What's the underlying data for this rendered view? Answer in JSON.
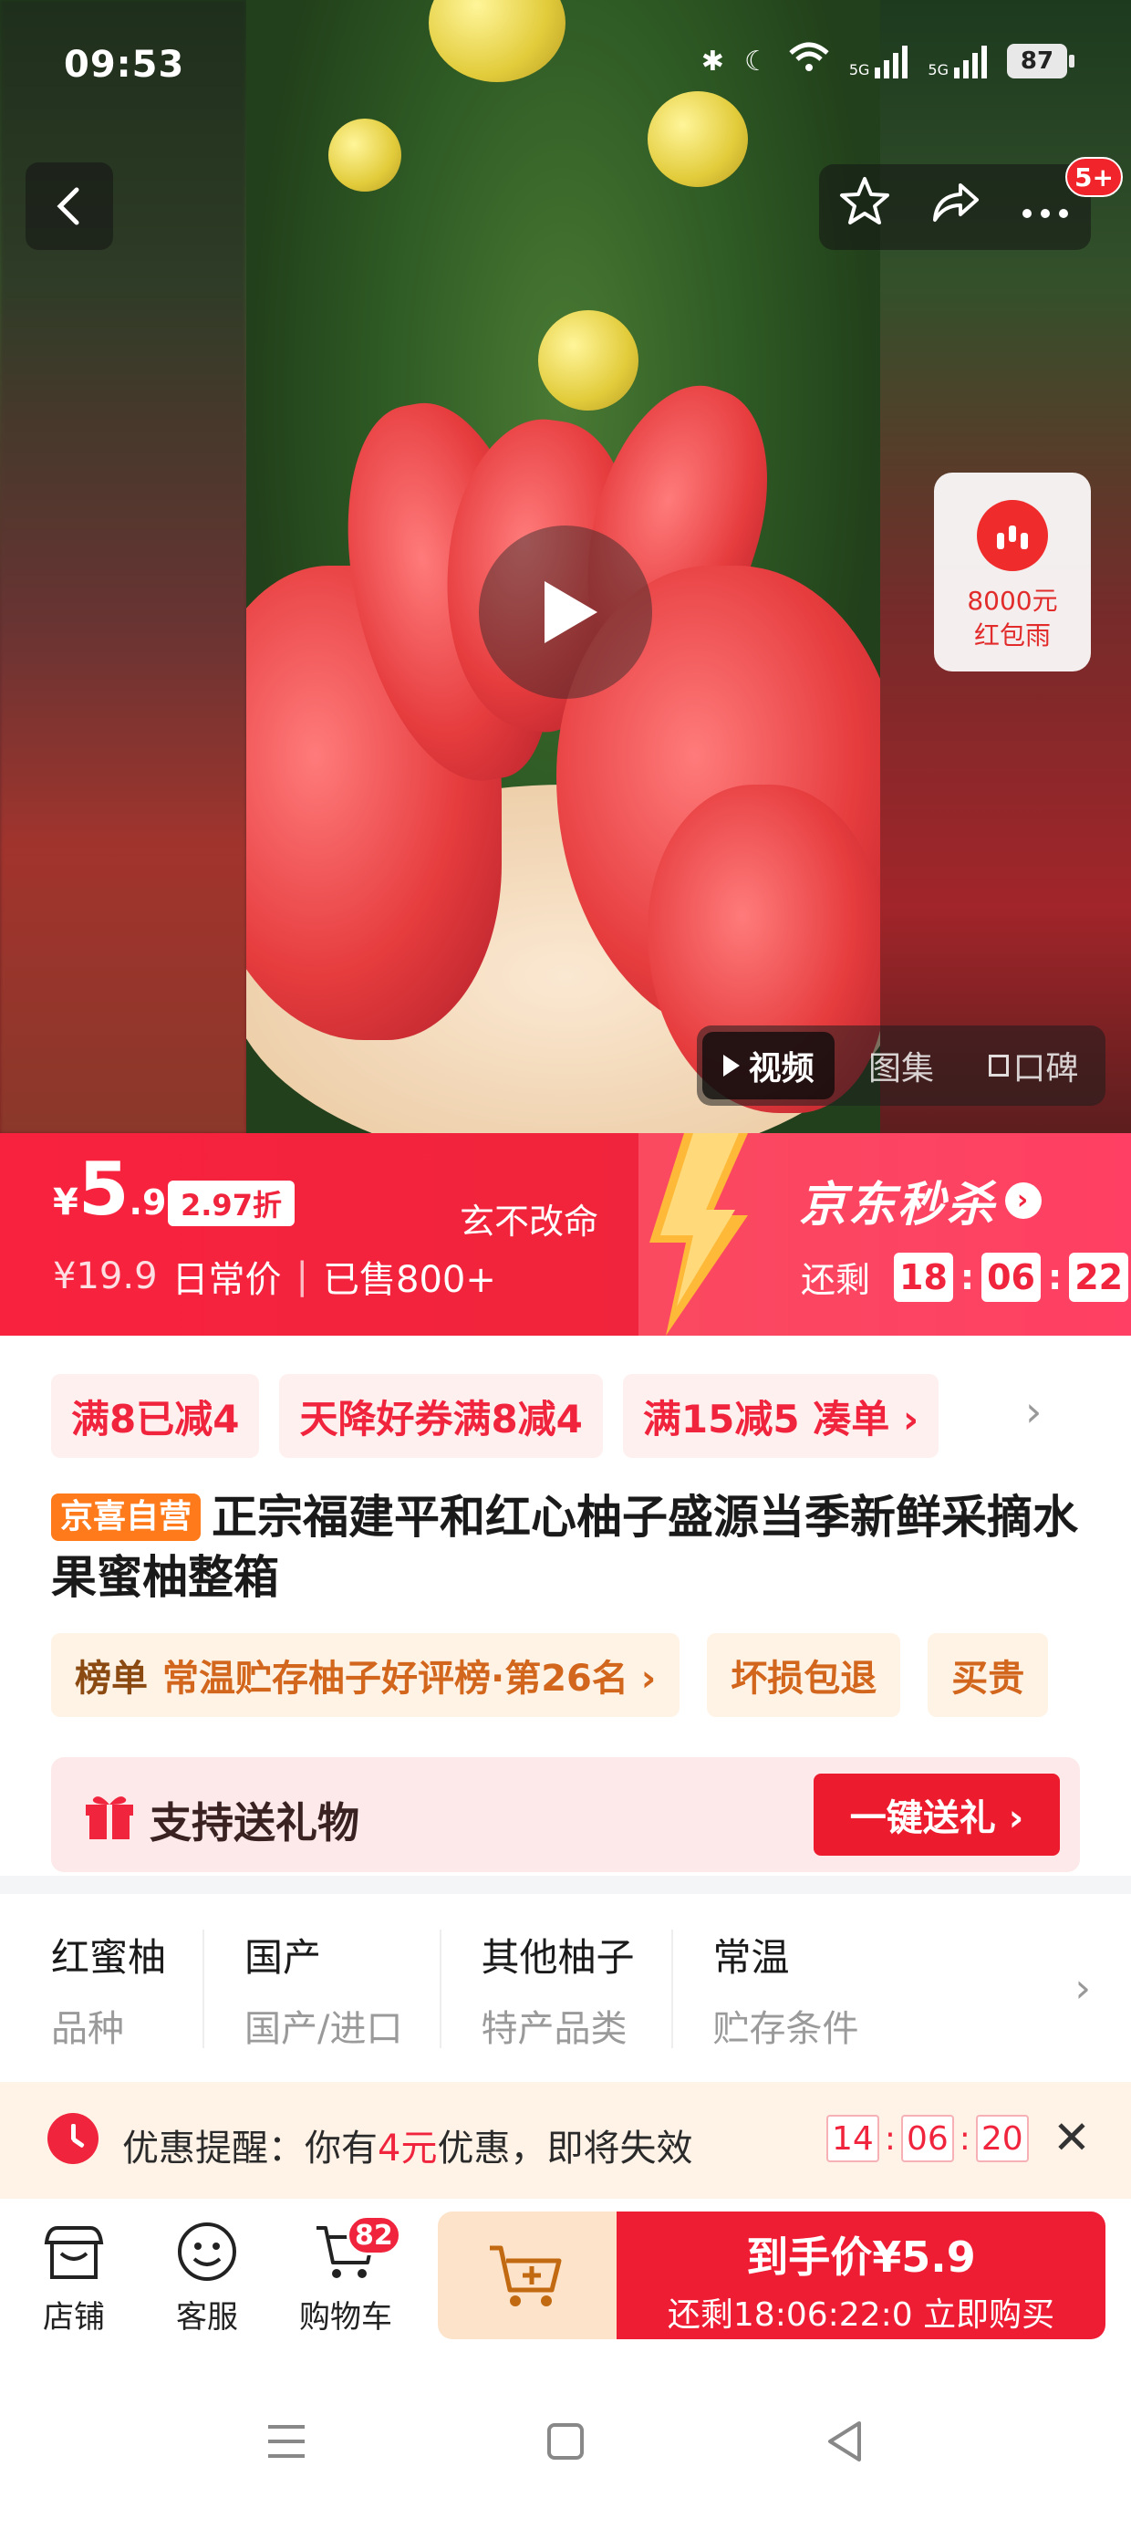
{
  "status_bar": {
    "time": "09:53",
    "net1": "5G",
    "net2": "5G",
    "battery": "87"
  },
  "top_actions": {
    "badge": "5+"
  },
  "red_packet": {
    "line1": "8000元",
    "line2": "红包雨"
  },
  "media_tabs": [
    {
      "label": "视频",
      "active": true
    },
    {
      "label": "图集",
      "active": false
    },
    {
      "label": "口碑",
      "active": false
    }
  ],
  "price": {
    "currency": "¥",
    "int": "5",
    "dec": ".9",
    "discount": "2.97折",
    "slogan": "玄不改命",
    "orig": "¥19.9",
    "orig_label": "日常价",
    "sep": "|",
    "sold": "已售800+"
  },
  "seckill": {
    "title": "京东秒杀",
    "remaining_label": "还剩",
    "hh": "18",
    "mm": "06",
    "ss": "22"
  },
  "coupons": [
    "满8已减4",
    "天降好券满8减4",
    "满15减5 凑单 ›"
  ],
  "product": {
    "tag": "京喜自营",
    "title": "正宗福建平和红心柚子盛源当季新鲜采摘水果蜜柚整箱"
  },
  "rank": {
    "head": "榜单",
    "text": "常温贮存柚子好评榜·第26名 ›",
    "service1": "坏损包退",
    "service2": "买贵"
  },
  "gift": {
    "label": "支持送礼物",
    "button": "一键送礼 ›"
  },
  "specs": [
    {
      "value": "红蜜柚",
      "key": "品种"
    },
    {
      "value": "国产",
      "key": "国产/进口"
    },
    {
      "value": "其他柚子",
      "key": "特产品类"
    },
    {
      "value": "常温",
      "key": "贮存条件"
    }
  ],
  "reminder": {
    "prefix": "优惠提醒：你有",
    "amount": "4元",
    "suffix": "优惠，即将失效",
    "hh": "14",
    "mm": "06",
    "ss": "20"
  },
  "bottom_bar": {
    "shop": "店铺",
    "service": "客服",
    "cart": "购物车",
    "cart_count": "82",
    "buy_main": "到手价¥5.9",
    "buy_sub": "还剩18:06:22:0 立即购买"
  },
  "colors": {
    "accent": "#f0243c",
    "brand_orange": "#ff7a1a"
  }
}
